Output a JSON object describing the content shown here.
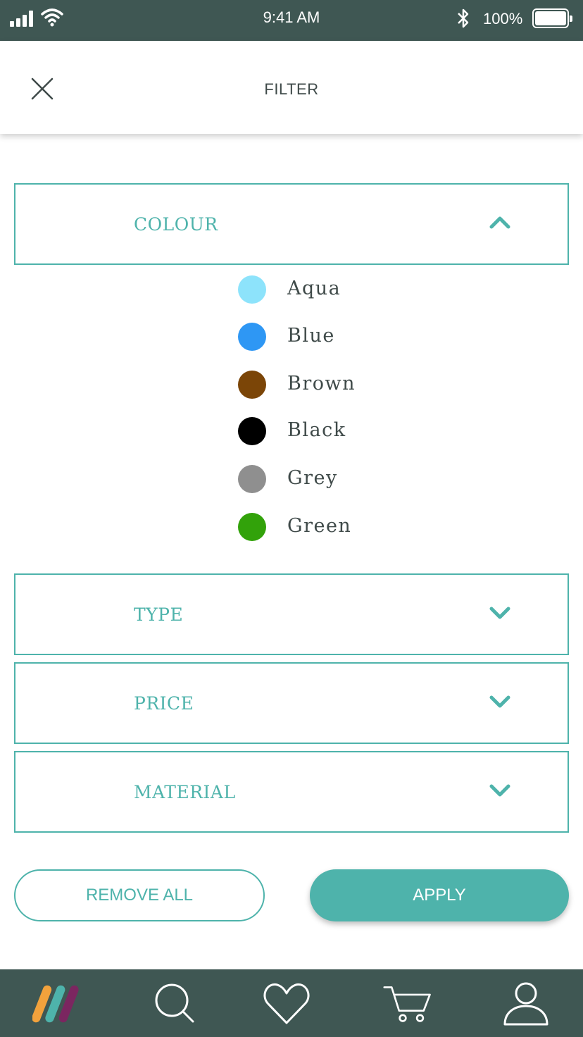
{
  "status_bar": {
    "time": "9:41 AM",
    "battery_percent": "100%"
  },
  "header": {
    "title": "FILTER",
    "close_icon": "close-icon"
  },
  "sections": [
    {
      "label": "COLOUR",
      "expanded": true,
      "icon": "chevron-up-icon"
    },
    {
      "label": "TYPE",
      "expanded": false,
      "icon": "chevron-down-icon"
    },
    {
      "label": "PRICE",
      "expanded": false,
      "icon": "chevron-down-icon"
    },
    {
      "label": "MATERIAL",
      "expanded": false,
      "icon": "chevron-down-icon"
    }
  ],
  "colours": [
    {
      "name": "Aqua",
      "color": "#8de3fb"
    },
    {
      "name": "Blue",
      "color": "#2e97f4"
    },
    {
      "name": "Brown",
      "color": "#7b4507"
    },
    {
      "name": "Black",
      "color": "#000000"
    },
    {
      "name": "Grey",
      "color": "#8f8f8f"
    },
    {
      "name": "Green",
      "color": "#32a20a"
    }
  ],
  "actions": {
    "remove_all": "REMOVE ALL",
    "apply": "APPLY"
  },
  "bottom_nav": [
    {
      "icon": "brand-logo-icon"
    },
    {
      "icon": "search-icon"
    },
    {
      "icon": "heart-icon"
    },
    {
      "icon": "cart-icon"
    },
    {
      "icon": "profile-icon"
    }
  ],
  "theme": {
    "accent": "#4eb3ab",
    "dark": "#3f5753",
    "text": "#3f4a49"
  }
}
